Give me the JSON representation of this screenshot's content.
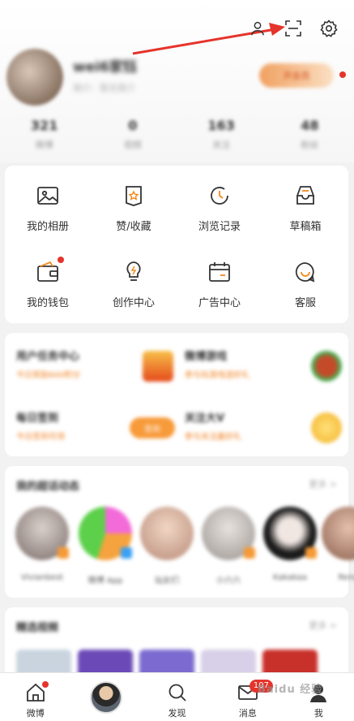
{
  "header": {
    "icons": [
      "user-icon",
      "scan-icon",
      "settings-icon"
    ]
  },
  "profile": {
    "nickname": "wei6家钰",
    "subinfo": "简介：暂无简介",
    "vip_label": "开会员"
  },
  "stats": [
    {
      "value": "321",
      "label": "微博"
    },
    {
      "value": "0",
      "label": "视频"
    },
    {
      "value": "163",
      "label": "关注"
    },
    {
      "value": "48",
      "label": "粉丝"
    }
  ],
  "grid": [
    {
      "label": "我的相册",
      "icon": "photo-album-icon"
    },
    {
      "label": "赞/收藏",
      "icon": "like-collect-icon"
    },
    {
      "label": "浏览记录",
      "icon": "history-icon"
    },
    {
      "label": "草稿箱",
      "icon": "drafts-icon"
    },
    {
      "label": "我的钱包",
      "icon": "wallet-icon"
    },
    {
      "label": "创作中心",
      "icon": "creator-center-icon"
    },
    {
      "label": "广告中心",
      "icon": "ad-center-icon"
    },
    {
      "label": "客服",
      "icon": "customer-service-icon"
    }
  ],
  "tasks": [
    {
      "title": "用户任务中心",
      "sub": "今日奖励600积分"
    },
    {
      "title": "微博游戏",
      "sub": "参与玩游戏送好礼"
    },
    {
      "title": "每日签到",
      "sub": "今日签到可领",
      "button": "签到"
    },
    {
      "title": "关注大V",
      "sub": "参与关注赢好礼"
    }
  ],
  "following": {
    "title": "我的超话动态",
    "more": "更多 >",
    "items": [
      "Vivianbest",
      "微博 App",
      "仙女们",
      "小六六",
      "Kakakaa",
      "Rena"
    ]
  },
  "recommend": {
    "title": "精选视频",
    "more": "更多 >"
  },
  "tabbar": {
    "tabs": [
      {
        "label": "微博"
      },
      {
        "label": ""
      },
      {
        "label": "发现"
      },
      {
        "label": "消息",
        "badge": "107"
      },
      {
        "label": "我"
      }
    ]
  },
  "watermark": "Baidu 经验"
}
